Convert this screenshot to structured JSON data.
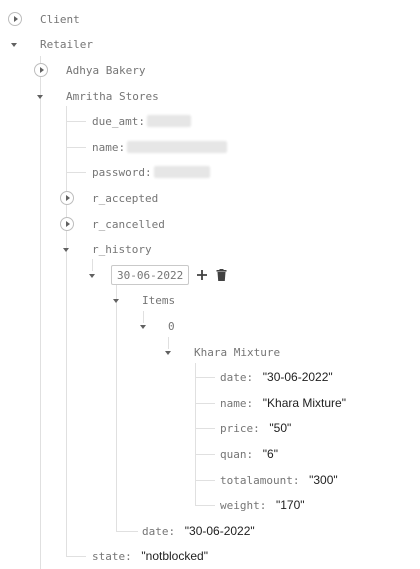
{
  "tree": {
    "client": "Client",
    "retailer": "Retailer",
    "adhya": "Adhya Bakery",
    "amritha": "Amritha Stores",
    "due_amt_key": "due_amt:",
    "name_key": "name:",
    "password_key": "password:",
    "r_accepted": "r_accepted",
    "r_cancelled": "r_cancelled",
    "r_history": "r_history",
    "history_date_key": "30-06-2022",
    "items": "Items",
    "index": "0",
    "product": "Khara Mixture",
    "fields": [
      {
        "key": "date:",
        "value": "\"30-06-2022\""
      },
      {
        "key": "name:",
        "value": "\"Khara Mixture\""
      },
      {
        "key": "price:",
        "value": "\"50\""
      },
      {
        "key": "quan:",
        "value": "\"6\""
      },
      {
        "key": "totalamount:",
        "value": "\"300\""
      },
      {
        "key": "weight:",
        "value": "\"170\""
      }
    ],
    "outer_date_key": "date:",
    "outer_date_value": "\"30-06-2022\"",
    "state_key": "state:",
    "state_value": "\"notblocked\""
  },
  "icons": {
    "add": "plus-icon",
    "delete": "trash-icon"
  }
}
